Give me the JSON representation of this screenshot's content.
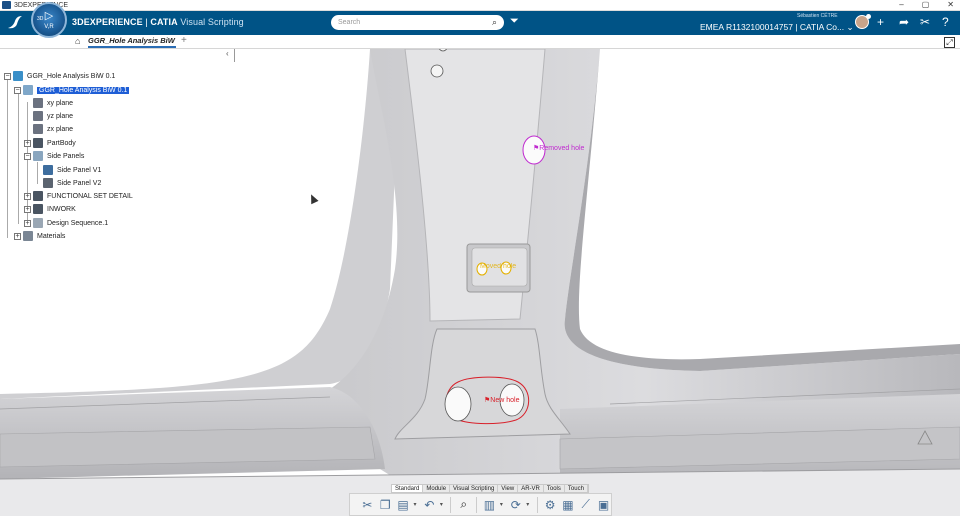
{
  "os_bar": {
    "title": "3DEXPERIENCE",
    "buttons": [
      "–",
      "▢",
      "✕"
    ]
  },
  "header": {
    "brand_bold": "3DEXPERIENCE",
    "brand_sep": " | ",
    "brand_app": "CATIA",
    "brand_sub": " Visual Scripting",
    "compass_label": "3D",
    "compass_version": "V,R",
    "search_placeholder": "Search",
    "tenant": "EMEA R1132100014757 | CATIA Co...",
    "tenant_caret": "⌄",
    "user_name": "Sébastien CÉTRE",
    "icons": {
      "search": "search-icon",
      "tag": "tag-icon",
      "add": "plus-icon",
      "share": "share-icon",
      "tools": "tools-icon",
      "help": "help-icon"
    }
  },
  "tabbar": {
    "doc_tab": "GGR_Hole Analysis BiW 0...",
    "add_tab": "+"
  },
  "tree": {
    "root": "GGR_Hole Analysis BiW 0.1",
    "product": "GGR_Hole Analysis BiW 0.1",
    "xy": "xy plane",
    "yz": "yz plane",
    "zx": "zx plane",
    "partbody": "PartBody",
    "side_panels": "Side Panels",
    "panel_v1": "Side Panel V1",
    "panel_v2": "Side Panel V2",
    "functional": "FUNCTIONAL SET DETAIL",
    "inwork": "INWORK",
    "design_seq": "Design Sequence.1",
    "materials": "Materials"
  },
  "annotations": {
    "removed": "Removed hole",
    "moved": "Moved hole",
    "new": "New hole",
    "colors": {
      "removed": "#c02ad0",
      "moved": "#e3b000",
      "new": "#d8202a"
    }
  },
  "section_tabs": [
    "Standard",
    "Module",
    "Visual Scripting",
    "View",
    "AR-VR",
    "Tools",
    "Touch"
  ],
  "action_bar": {
    "icons": [
      "cut-icon",
      "copy-icon",
      "paste-icon",
      "undo-icon",
      "zoom-icon",
      "book-icon",
      "update-icon",
      "analysis-icon",
      "compare-icon",
      "chart-icon",
      "panel-icon"
    ]
  }
}
